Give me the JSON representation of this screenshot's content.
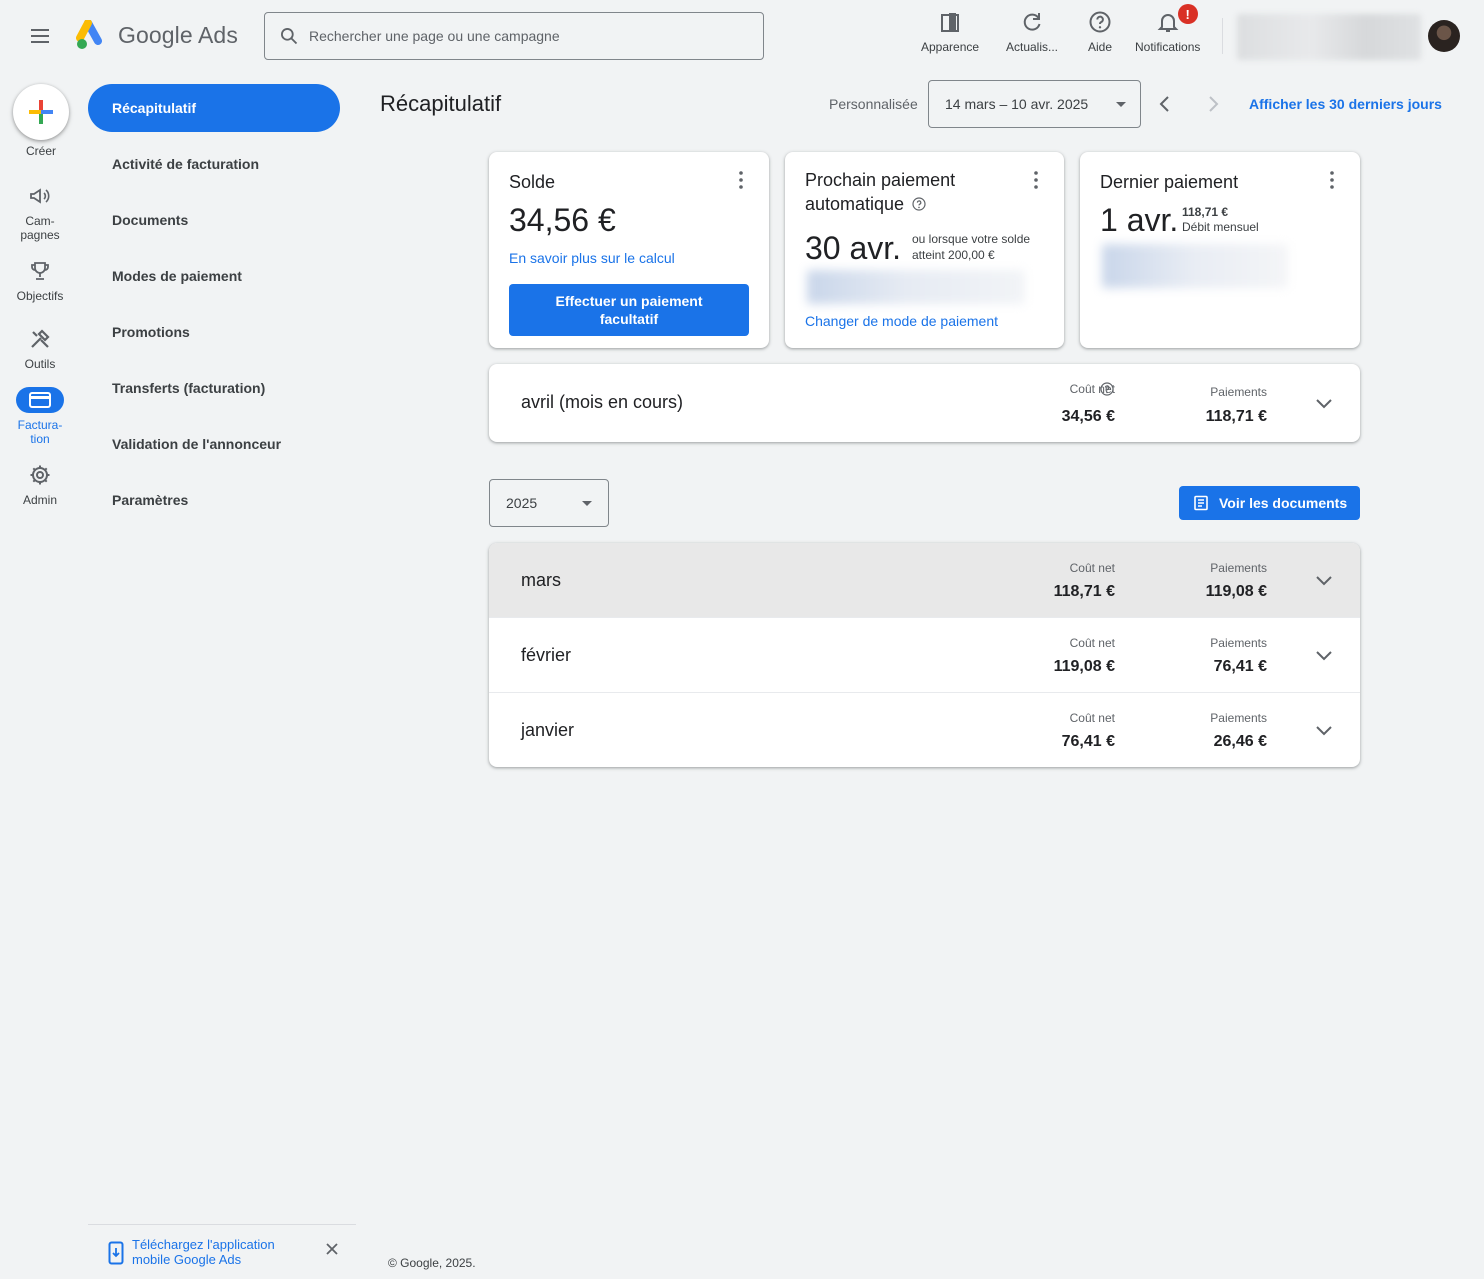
{
  "header": {
    "app_name": "Google Ads",
    "search_placeholder": "Rechercher une page ou une campagne",
    "actions": {
      "appearance": "Apparence",
      "refresh": "Actualis...",
      "help": "Aide",
      "notifications": "Notifications",
      "notifications_badge": "!"
    }
  },
  "rail": {
    "create": "Créer",
    "campaigns_line1": "Cam-",
    "campaigns_line2": "pagnes",
    "goals": "Objectifs",
    "tools": "Outils",
    "billing_line1": "Factura-",
    "billing_line2": "tion",
    "admin": "Admin"
  },
  "nav": {
    "items": [
      {
        "label": "Récapitulatif",
        "active": true
      },
      {
        "label": "Activité de facturation"
      },
      {
        "label": "Documents"
      },
      {
        "label": "Modes de paiement"
      },
      {
        "label": "Promotions"
      },
      {
        "label": "Transferts (facturation)"
      },
      {
        "label": "Validation de l'annonceur"
      },
      {
        "label": "Paramètres"
      }
    ]
  },
  "page": {
    "title": "Récapitulatif",
    "range_type": "Personnalisée",
    "date_range": "14 mars – 10 avr. 2025",
    "last30_link": "Afficher les 30 derniers jours"
  },
  "cards": {
    "balance": {
      "title": "Solde",
      "amount": "34,56 €",
      "link": "En savoir plus sur le calcul",
      "button_line1": "Effectuer un paiement",
      "button_line2": "facultatif"
    },
    "next_payment": {
      "title_line1": "Prochain paiement",
      "title_line2": "automatique",
      "date": "30 avr.",
      "note_line1": "ou lorsque votre solde",
      "note_line2": "atteint 200,00 €",
      "link": "Changer de mode de paiement"
    },
    "last_payment": {
      "title": "Dernier paiement",
      "date": "1 avr.",
      "amount": "118,71 €",
      "type": "Débit mensuel"
    }
  },
  "current_month": {
    "label": "avril (mois en cours)",
    "net_cost_label": "Coût net",
    "net_cost": "34,56 €",
    "payments_label": "Paiements",
    "payments": "118,71 €"
  },
  "year_select": "2025",
  "documents_button": "Voir les documents",
  "months": [
    {
      "label": "mars",
      "net_cost_label": "Coût net",
      "net_cost": "118,71 €",
      "payments_label": "Paiements",
      "payments": "119,08 €"
    },
    {
      "label": "février",
      "net_cost_label": "Coût net",
      "net_cost": "119,08 €",
      "payments_label": "Paiements",
      "payments": "76,41 €"
    },
    {
      "label": "janvier",
      "net_cost_label": "Coût net",
      "net_cost": "76,41 €",
      "payments_label": "Paiements",
      "payments": "26,46 €"
    }
  ],
  "footer": {
    "app_promo_line1": "Téléchargez l'application",
    "app_promo_line2": "mobile Google Ads",
    "copyright": "© Google, 2025."
  },
  "colors": {
    "accent": "#1a73e8",
    "background": "#f1f3f4",
    "alert": "#d93025"
  }
}
